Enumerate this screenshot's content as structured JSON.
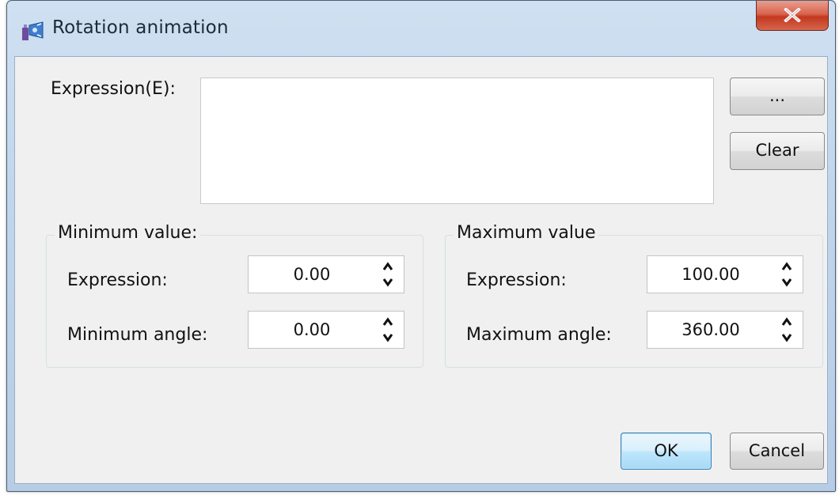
{
  "window": {
    "title": "Rotation animation",
    "icon": "rotation-app-icon",
    "close_icon": "close-icon"
  },
  "expression": {
    "label": "Expression(E):",
    "value": "",
    "browse_label": "...",
    "clear_label": "Clear"
  },
  "minimum": {
    "group_title": "Minimum value:",
    "expression_label": "Expression:",
    "expression_value": "0.00",
    "angle_label": "Minimum angle:",
    "angle_value": "0.00"
  },
  "maximum": {
    "group_title": "Maximum value",
    "expression_label": "Expression:",
    "expression_value": "100.00",
    "angle_label": "Maximum angle:",
    "angle_value": "360.00"
  },
  "footer": {
    "ok_label": "OK",
    "cancel_label": "Cancel"
  },
  "colors": {
    "close_button": "#c2381f",
    "ok_button_border": "#3c7fb1",
    "dialog_background": "#f0f0f0"
  }
}
